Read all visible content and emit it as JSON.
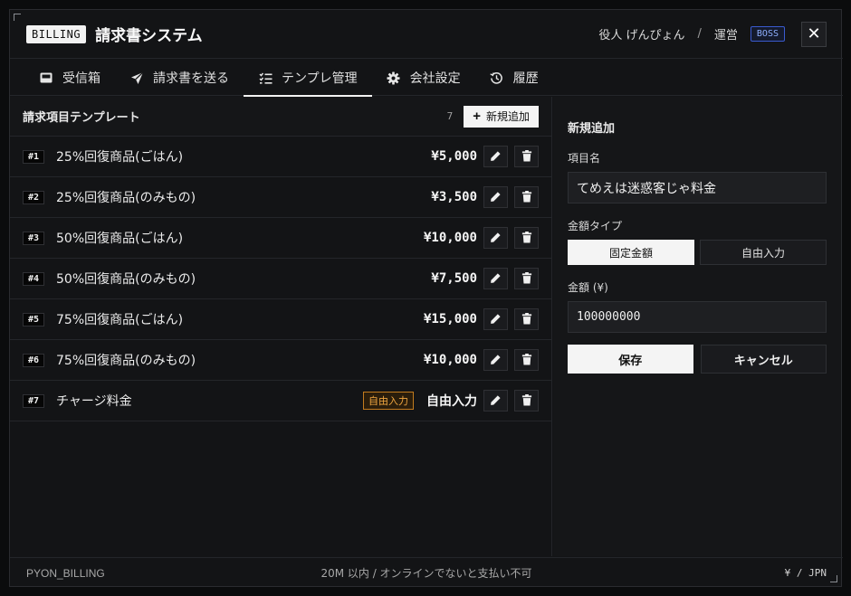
{
  "header": {
    "badge": "BILLING",
    "title": "請求書システム",
    "user_name": "役人 げんぴょん",
    "separator": "/",
    "role": "運営",
    "role_badge": "BOSS",
    "close_label": "✕"
  },
  "tabs": [
    {
      "label": "受信箱",
      "icon": "inbox-icon"
    },
    {
      "label": "請求書を送る",
      "icon": "send-icon"
    },
    {
      "label": "テンプレ管理",
      "icon": "list-check-icon",
      "active": true
    },
    {
      "label": "会社設定",
      "icon": "gear-icon"
    },
    {
      "label": "履歴",
      "icon": "history-icon"
    }
  ],
  "list": {
    "title": "請求項目テンプレート",
    "count": "7",
    "add_label": "新規追加",
    "items": [
      {
        "num": "#1",
        "name": "25%回復商品(ごはん)",
        "price": "¥5,000"
      },
      {
        "num": "#2",
        "name": "25%回復商品(のみもの)",
        "price": "¥3,500"
      },
      {
        "num": "#3",
        "name": "50%回復商品(ごはん)",
        "price": "¥10,000"
      },
      {
        "num": "#4",
        "name": "50%回復商品(のみもの)",
        "price": "¥7,500"
      },
      {
        "num": "#5",
        "name": "75%回復商品(ごはん)",
        "price": "¥15,000"
      },
      {
        "num": "#6",
        "name": "75%回復商品(のみもの)",
        "price": "¥10,000"
      },
      {
        "num": "#7",
        "name": "チャージ料金",
        "tag": "自由入力",
        "price": "自由入力"
      }
    ]
  },
  "form": {
    "title": "新規追加",
    "name_label": "項目名",
    "name_value": "てめえは迷惑客じゃ料金",
    "type_label": "金額タイプ",
    "type_fixed": "固定金額",
    "type_free": "自由入力",
    "amount_label": "金額 (¥)",
    "amount_value": "100000000",
    "save_label": "保存",
    "cancel_label": "キャンセル"
  },
  "footer": {
    "left": "PYON_BILLING",
    "middle": "20M 以内 / オンラインでないと支払い不可",
    "right": "¥ / JPN"
  },
  "colors": {
    "background": "#131416",
    "accent_tag": "#f0a640",
    "boss_badge": "#8fb0ff"
  }
}
